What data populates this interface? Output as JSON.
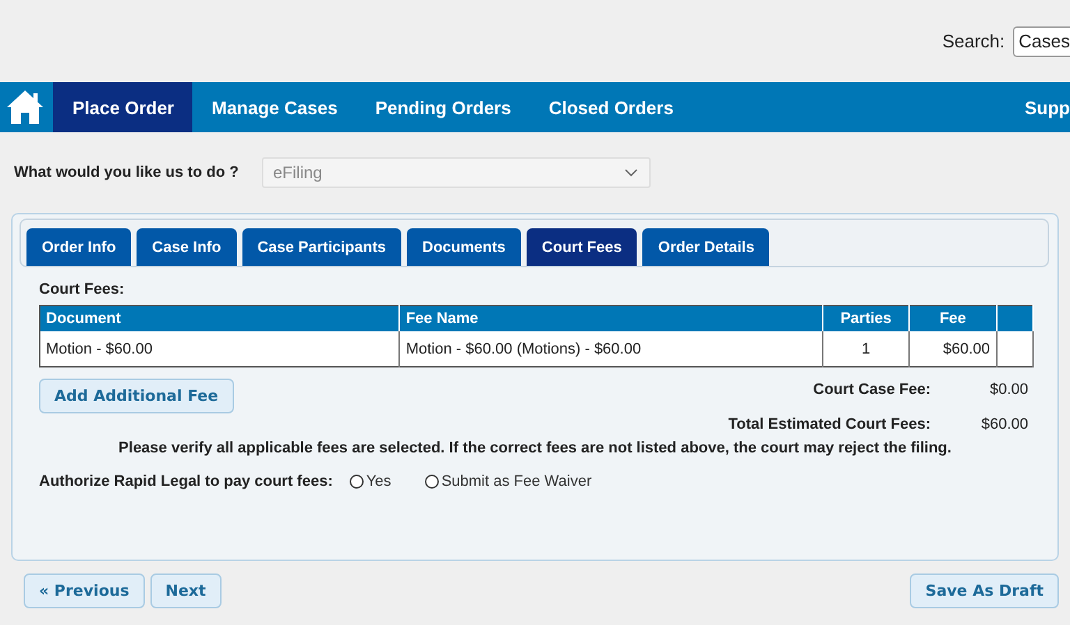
{
  "search": {
    "label": "Search:",
    "value": "Cases"
  },
  "nav": [
    {
      "label": "Place Order",
      "selected": true
    },
    {
      "label": "Manage Cases",
      "selected": false
    },
    {
      "label": "Pending Orders",
      "selected": false
    },
    {
      "label": "Closed Orders",
      "selected": false
    },
    {
      "label": "Supp",
      "selected": false
    }
  ],
  "question": {
    "label": "What would you like us to do ?",
    "value": "eFiling",
    "disabled": true
  },
  "tabs": [
    {
      "label": "Order Info",
      "selected": false
    },
    {
      "label": "Case Info",
      "selected": false
    },
    {
      "label": "Case Participants",
      "selected": false
    },
    {
      "label": "Documents",
      "selected": false
    },
    {
      "label": "Court Fees",
      "selected": true
    },
    {
      "label": "Order Details",
      "selected": false
    }
  ],
  "section_title": "Court Fees:",
  "table": {
    "columns": [
      "Document",
      "Fee Name",
      "Parties",
      "Fee"
    ],
    "rows": [
      [
        "Motion - $60.00",
        "Motion - $60.00 (Motions) - $60.00",
        "1",
        "$60.00"
      ]
    ]
  },
  "add_fee_button": "Add Additional Fee",
  "totals": [
    {
      "label": "Court Case Fee:",
      "value": "$0.00"
    },
    {
      "label": "Total Estimated Court Fees:",
      "value": "$60.00"
    }
  ],
  "notice": "Please verify all applicable fees are selected. If the correct fees are not listed above, the court may reject the filing.",
  "authorize": {
    "label": "Authorize Rapid Legal to pay court fees:",
    "options": [
      {
        "label": "Yes",
        "selected": false
      },
      {
        "label": "Submit as Fee Waiver",
        "selected": false
      }
    ]
  },
  "footer": {
    "previous": "« Previous",
    "next": "Next",
    "save": "Save As Draft"
  }
}
